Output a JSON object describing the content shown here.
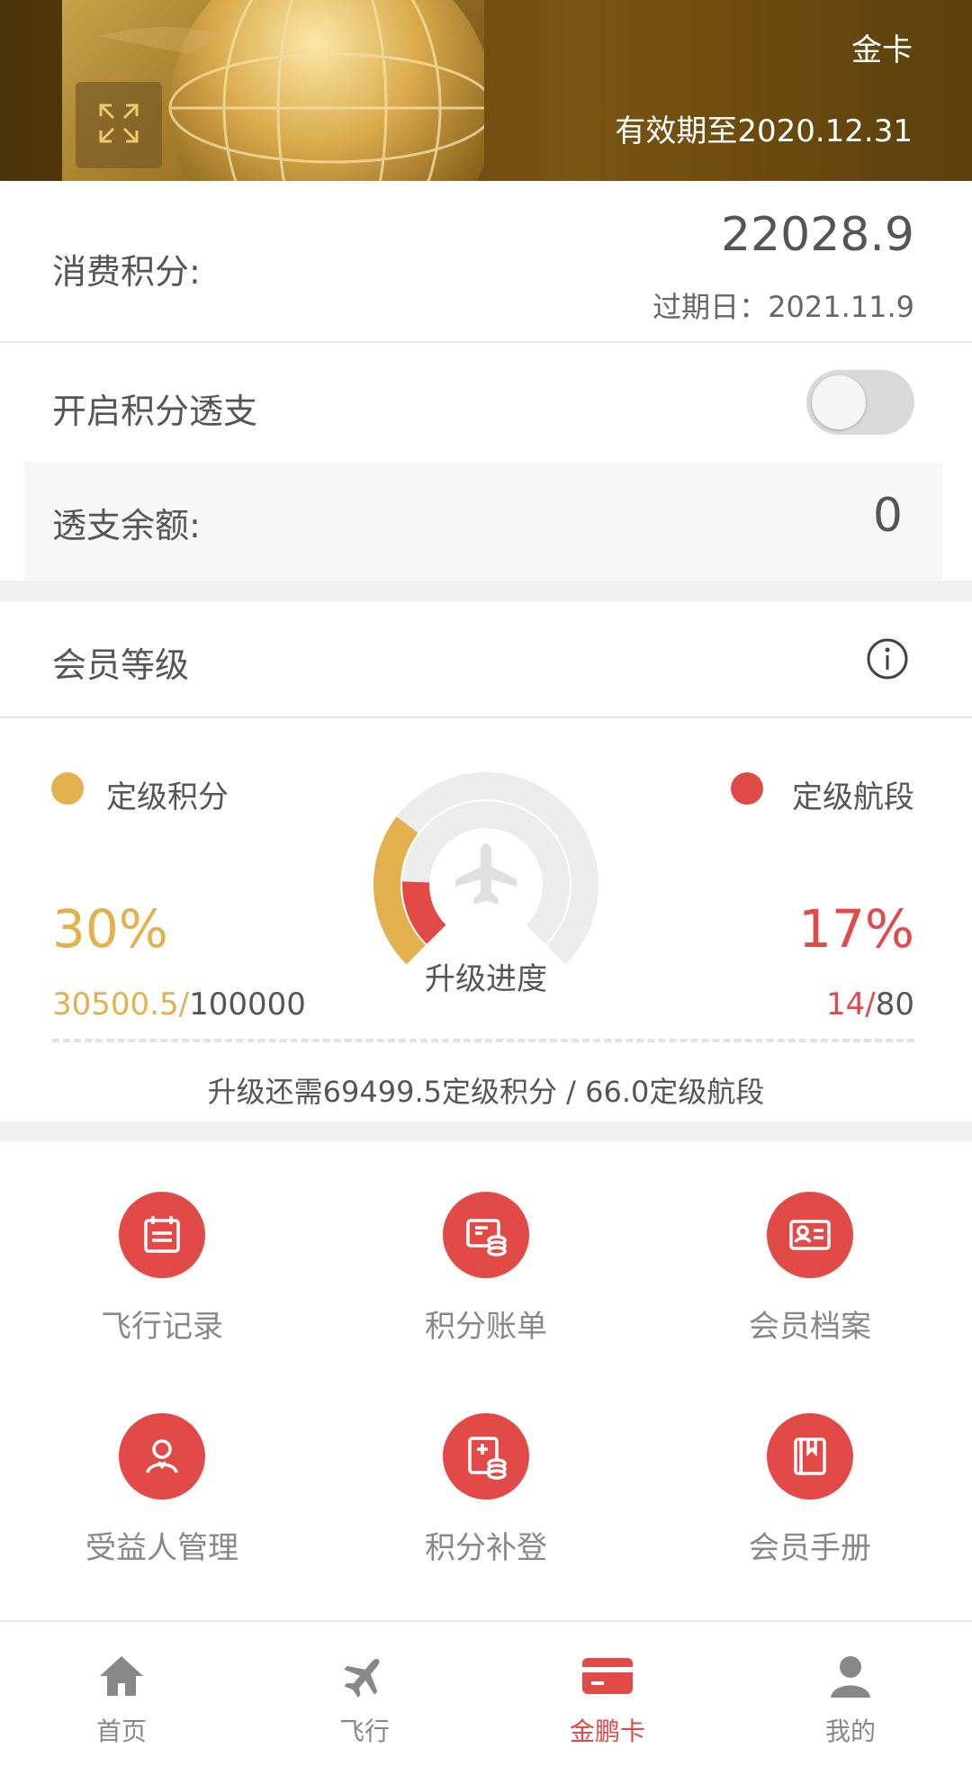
{
  "card": {
    "type": "金卡",
    "valid_until": "有效期至2020.12.31"
  },
  "points": {
    "label": "消费积分:",
    "value": "22028.9",
    "expiry": "过期日：2021.11.9"
  },
  "overdraft": {
    "toggle_label": "开启积分透支",
    "enabled": false,
    "balance_label": "透支余额:",
    "balance_value": "0"
  },
  "level": {
    "title": "会员等级"
  },
  "progress": {
    "left_legend": "定级积分",
    "right_legend": "定级航段",
    "left_percent": "30%",
    "right_percent": "17%",
    "left_current": "30500.5/",
    "left_total": "100000",
    "right_current": "14/",
    "right_total": "80",
    "center_label": "升级进度",
    "points_fraction": 0.305,
    "segments_fraction": 0.175,
    "remaining": "升级还需69499.5定级积分 / 66.0定级航段"
  },
  "tiles": [
    {
      "label": "飞行记录",
      "icon": "calendar-icon"
    },
    {
      "label": "积分账单",
      "icon": "bill-icon"
    },
    {
      "label": "会员档案",
      "icon": "profile-card-icon"
    },
    {
      "label": "受益人管理",
      "icon": "beneficiary-icon"
    },
    {
      "label": "积分补登",
      "icon": "points-add-icon"
    },
    {
      "label": "会员手册",
      "icon": "handbook-icon"
    }
  ],
  "tabs": [
    {
      "label": "首页",
      "icon": "home-icon"
    },
    {
      "label": "飞行",
      "icon": "plane-icon"
    },
    {
      "label": "金鹏卡",
      "icon": "card-icon",
      "active": true
    },
    {
      "label": "我的",
      "icon": "user-icon"
    }
  ],
  "colors": {
    "gold": "#e2b04c",
    "red": "#e24a48",
    "inactive": "#888888"
  }
}
